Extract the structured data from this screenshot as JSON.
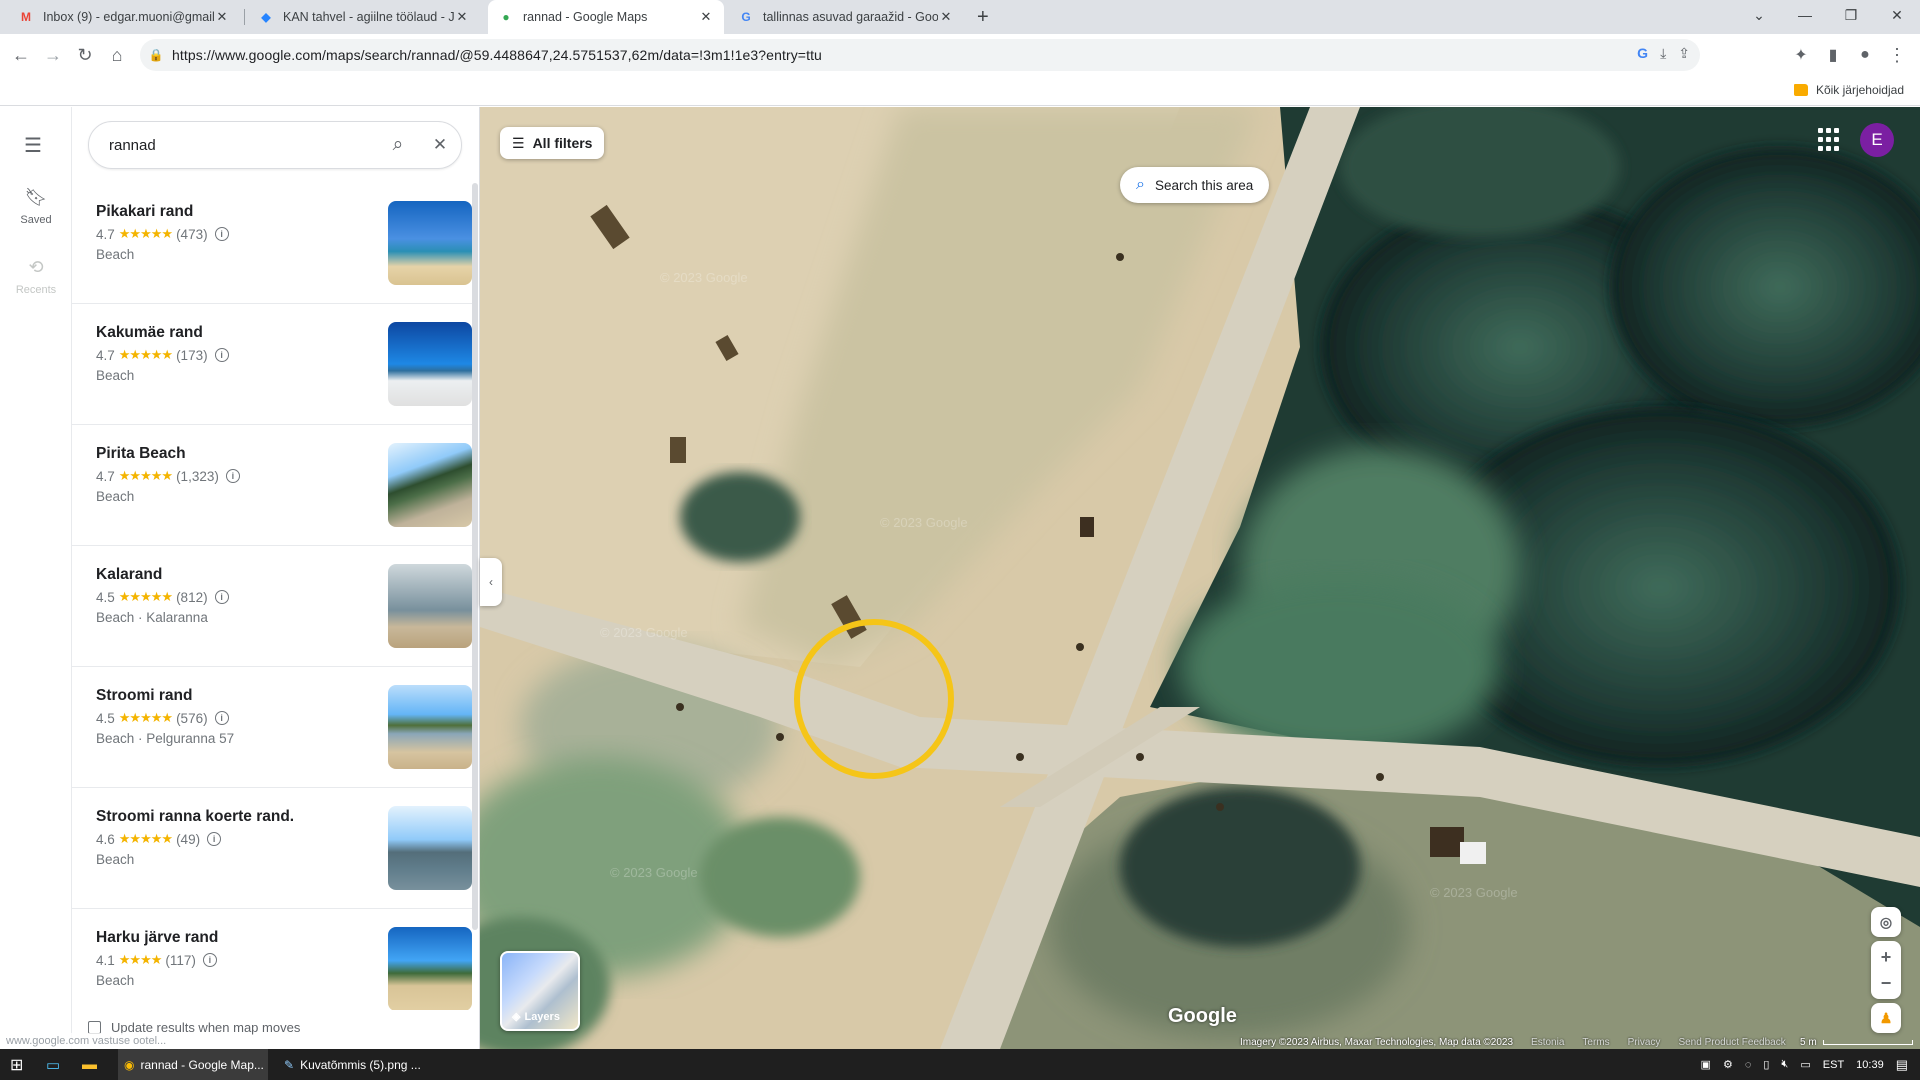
{
  "browser": {
    "tabs": [
      {
        "title": "Inbox (9) - edgar.muoni@gmail.",
        "icon": "gmail-icon"
      },
      {
        "title": "KAN tahvel - agiilne töölaud - Ji",
        "icon": "jira-icon"
      },
      {
        "title": "rannad - Google Maps",
        "icon": "maps-pin-icon"
      },
      {
        "title": "tallinnas asuvad garaažid - Goog",
        "icon": "google-icon"
      }
    ],
    "url": "https://www.google.com/maps/search/rannad/@59.4488647,24.5751537,62m/data=!3m1!1e3?entry=ttu",
    "bookmarks_label": "Kõik järjehoidjad"
  },
  "rail": {
    "saved_label": "Saved",
    "recents_label": "Recents"
  },
  "search": {
    "query": "rannad"
  },
  "results": [
    {
      "name": "Pikakari rand",
      "rating": "4.7",
      "stars": "★★★★★",
      "reviews": "(473)",
      "type": "Beach"
    },
    {
      "name": "Kakumäe rand",
      "rating": "4.7",
      "stars": "★★★★★",
      "reviews": "(173)",
      "type": "Beach"
    },
    {
      "name": "Pirita Beach",
      "rating": "4.7",
      "stars": "★★★★★",
      "reviews": "(1,323)",
      "type": "Beach"
    },
    {
      "name": "Kalarand",
      "rating": "4.5",
      "stars": "★★★★★",
      "reviews": "(812)",
      "type": "Beach · Kalaranna"
    },
    {
      "name": "Stroomi rand",
      "rating": "4.5",
      "stars": "★★★★★",
      "reviews": "(576)",
      "type": "Beach · Pelguranna 57"
    },
    {
      "name": "Stroomi ranna koerte rand.",
      "rating": "4.6",
      "stars": "★★★★★",
      "reviews": "(49)",
      "type": "Beach"
    },
    {
      "name": "Harku järve rand",
      "rating": "4.1",
      "stars": "★★★★",
      "reviews": "(117)",
      "type": "Beach"
    }
  ],
  "update_label": "Update results when map moves",
  "status_url": "www.google.com vastuse ootel...",
  "map": {
    "all_filters": "All filters",
    "search_area": "Search this area",
    "avatar_letter": "E",
    "layers_label": "Layers",
    "logo": "Google",
    "attribution": "Imagery ©2023 Airbus, Maxar Technologies, Map data ©2023",
    "links": [
      "Estonia",
      "Terms",
      "Privacy",
      "Send Product Feedback"
    ],
    "scale": "5 m",
    "watermark": "© 2023 Google",
    "highlight_color": "#f5c518"
  },
  "taskbar": {
    "items": [
      "rannad - Google Map...",
      "Kuvatõmmis (5).png ..."
    ],
    "lang": "EST",
    "time": "10:39"
  }
}
